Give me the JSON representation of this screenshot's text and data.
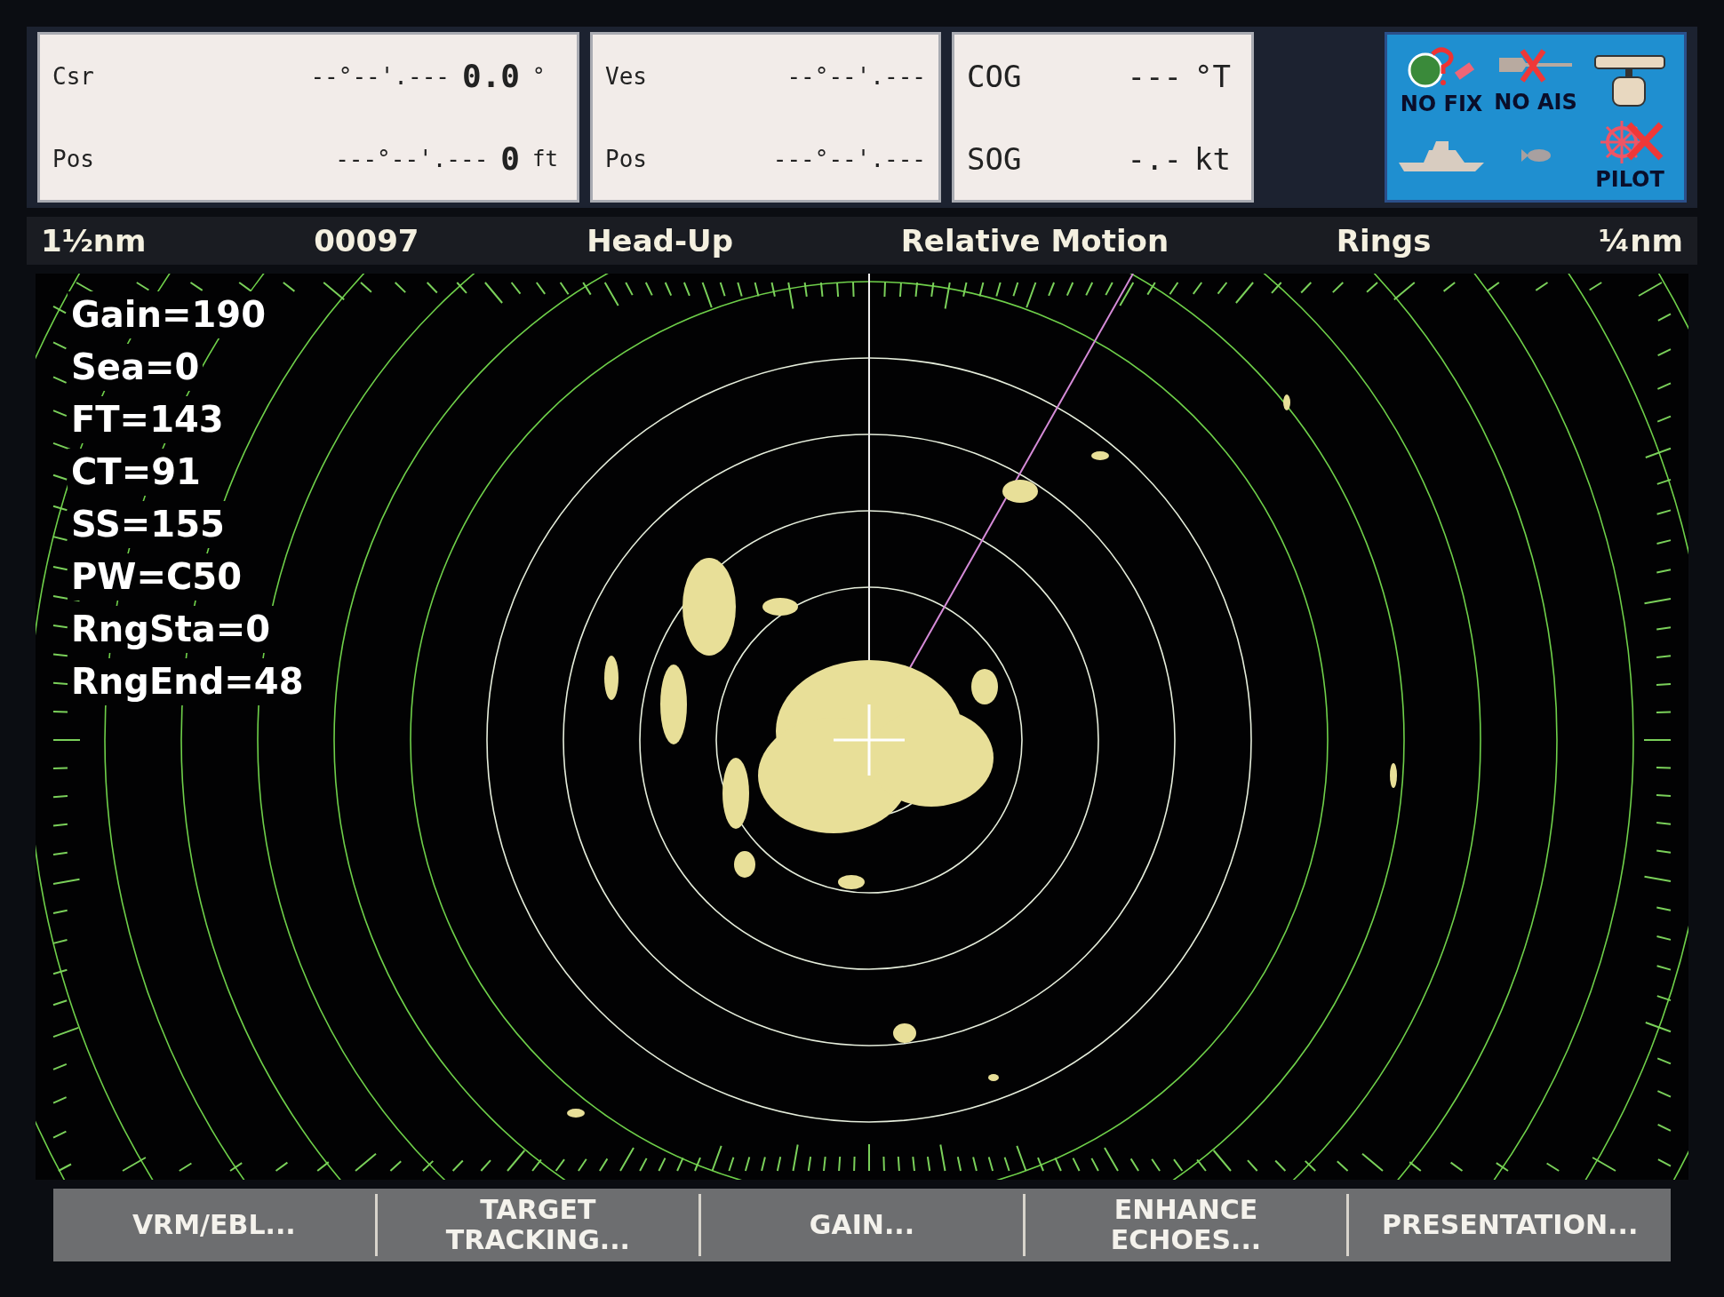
{
  "data_boxes": [
    {
      "rows": [
        {
          "label": "Csr",
          "coordinate": "--°--'.---",
          "value": "0.0",
          "unit": "°"
        },
        {
          "label": "Pos",
          "coordinate": "---°--'.---",
          "value": "0",
          "unit": "ft"
        }
      ]
    },
    {
      "rows": [
        {
          "label": "Ves",
          "coordinate": "--°--'.---"
        },
        {
          "label": "Pos",
          "coordinate": "---°--'.---"
        }
      ]
    },
    {
      "rows": [
        {
          "label": "COG",
          "value": "---",
          "unit": "°T"
        },
        {
          "label": "SOG",
          "value": "-.-",
          "unit": "kt"
        }
      ]
    }
  ],
  "status_panel": [
    {
      "kind": "gps",
      "label": "NO FIX"
    },
    {
      "kind": "ais",
      "label": "NO AIS",
      "crossed": true
    },
    {
      "kind": "radar",
      "crossed": false
    },
    {
      "kind": "boat",
      "crossed": false
    },
    {
      "kind": "fish",
      "crossed": false
    },
    {
      "kind": "pilot",
      "label": "PILOT",
      "crossed": true
    }
  ],
  "header": [
    "1½nm",
    "00097",
    "Head-Up",
    "Relative Motion",
    "Rings",
    "¼nm"
  ],
  "readouts": [
    "Gain=190",
    "Sea=0",
    "FT=143",
    "CT=91",
    "SS=155",
    "PW=C50",
    "RngSta=0",
    "RngEnd=48"
  ],
  "softkeys": [
    "VRM/EBL...",
    "TARGET\nTRACKING...",
    "GAIN...",
    "ENHANCE\nECHOES...",
    "PRESENTATION..."
  ]
}
